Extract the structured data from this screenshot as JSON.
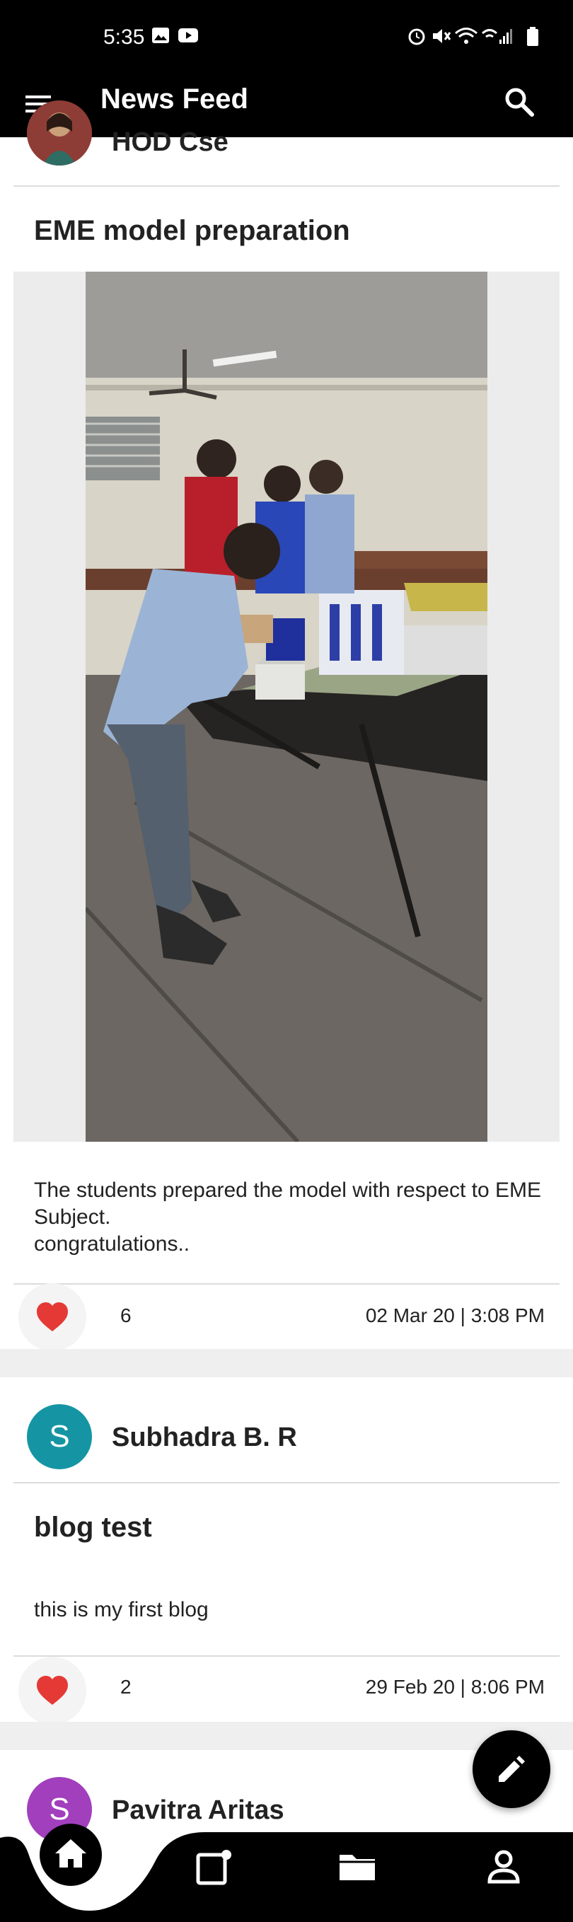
{
  "status_bar": {
    "time": "5:35"
  },
  "app_bar": {
    "title": "News Feed",
    "menu_icon": "hamburger-menu-icon",
    "search_icon": "search-icon"
  },
  "posts": [
    {
      "author": "HOD Cse",
      "title": "EME model preparation",
      "body": "The students prepared the model with respect to EME Subject.\ncongratulations..",
      "likes": "6",
      "timestamp": "02 Mar 20 | 3:08 PM",
      "has_image": true
    },
    {
      "author": "Subhadra B. R",
      "avatar_letter": "S",
      "avatar_color": "#1595a3",
      "title": "blog test",
      "body": "this is my first blog",
      "likes": "2",
      "timestamp": "29 Feb 20 | 8:06 PM"
    },
    {
      "author": "Pavitra Aritas",
      "avatar_letter": "S",
      "avatar_color": "#a23fbd"
    }
  ],
  "fab": {
    "icon": "pencil-icon"
  },
  "bottom_nav": {
    "items": [
      {
        "icon": "home-icon",
        "active": true
      },
      {
        "icon": "notes-icon",
        "active": false
      },
      {
        "icon": "folder-icon",
        "active": false
      },
      {
        "icon": "profile-icon",
        "active": false
      }
    ]
  },
  "colors": {
    "heart": "#e53935",
    "bar": "#000000"
  }
}
